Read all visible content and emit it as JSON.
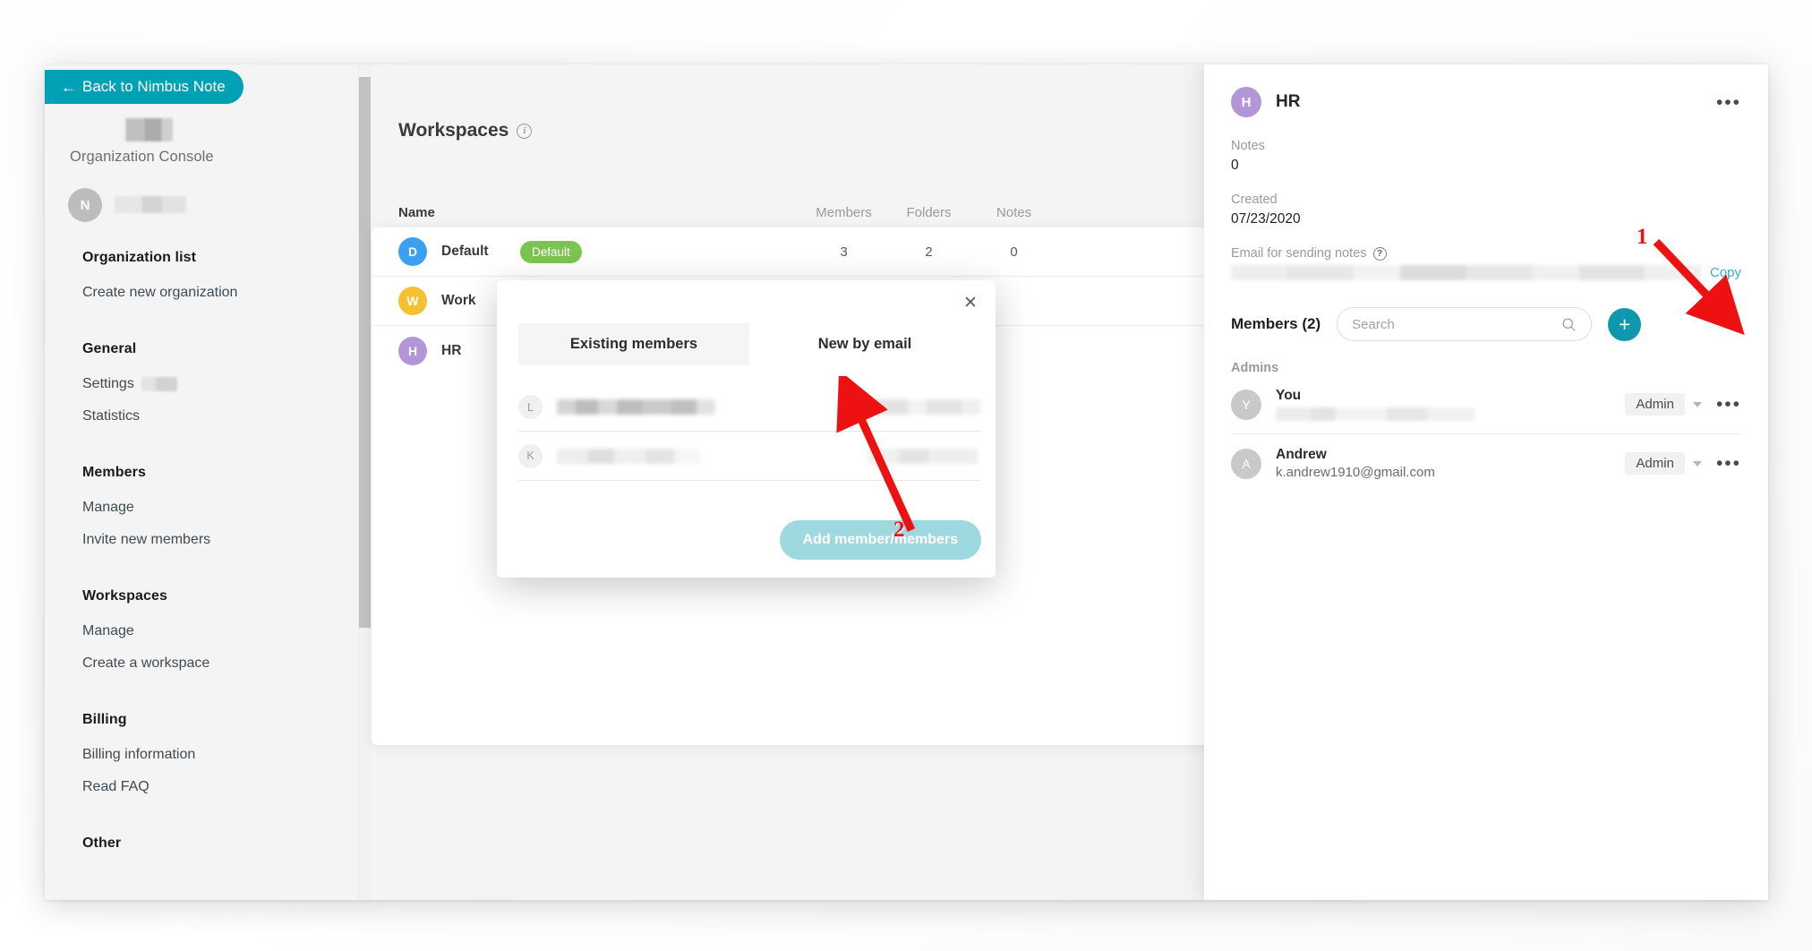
{
  "sidebar": {
    "back_button": "Back to Nimbus Note",
    "back_arrow": "←",
    "org_console_label": "Organization Console",
    "org_avatar_initial": "N",
    "groups": [
      {
        "heading": "Organization list",
        "items": [
          "Create new organization"
        ]
      },
      {
        "heading": "General",
        "items": [
          "Settings",
          "Statistics"
        ]
      },
      {
        "heading": "Members",
        "items": [
          "Manage",
          "Invite new members"
        ]
      },
      {
        "heading": "Workspaces",
        "items": [
          "Manage",
          "Create a workspace"
        ]
      },
      {
        "heading": "Billing",
        "items": [
          "Billing information",
          "Read FAQ"
        ]
      },
      {
        "heading": "Other",
        "items": []
      }
    ]
  },
  "main": {
    "page_title": "Workspaces",
    "info_icon_glyph": "i",
    "columns": [
      "Name",
      "Members",
      "Folders",
      "Notes"
    ],
    "rows": [
      {
        "initial": "D",
        "name": "Default",
        "badge": "Default",
        "members": "3",
        "folders": "2",
        "notes": "0",
        "color": "#3aa0ef"
      },
      {
        "initial": "W",
        "name": "Work",
        "badge": "",
        "members": "",
        "folders": "",
        "notes": "",
        "color": "#f5c130"
      },
      {
        "initial": "H",
        "name": "HR",
        "badge": "",
        "members": "",
        "folders": "",
        "notes": "",
        "color": "#b296d8"
      }
    ]
  },
  "modal": {
    "close_glyph": "✕",
    "tabs": [
      {
        "label": "Existing members",
        "active": true
      },
      {
        "label": "New by email",
        "active": false
      }
    ],
    "rows": [
      {
        "initial": "L"
      },
      {
        "initial": "K"
      }
    ],
    "add_button": "Add member/members"
  },
  "right_panel": {
    "avatar_initial": "H",
    "title": "HR",
    "menu_glyph": "•••",
    "notes_label": "Notes",
    "notes_value": "0",
    "created_label": "Created",
    "created_value": "07/23/2020",
    "email_label": "Email for sending notes",
    "help_glyph": "?",
    "copy_label": "Copy",
    "members_title": "Members (2)",
    "search_placeholder": "Search",
    "search_value": "",
    "add_glyph": "+",
    "admins_label": "Admins",
    "members": [
      {
        "initial": "Y",
        "name": "You",
        "email": "",
        "email_hidden": true,
        "role": "Admin"
      },
      {
        "initial": "A",
        "name": "Andrew",
        "email": "k.andrew1910@gmail.com",
        "email_hidden": false,
        "role": "Admin"
      }
    ]
  },
  "annotations": [
    {
      "number": "1",
      "target": "add-member-fab"
    },
    {
      "number": "2",
      "target": "existing-members-tab"
    }
  ],
  "colors": {
    "accent_teal": "#00a0b5",
    "fab_teal": "#0d98ae",
    "badge_green": "#7cc451",
    "annotation_red": "#ee1111",
    "link_blue": "#3fa9c6"
  }
}
